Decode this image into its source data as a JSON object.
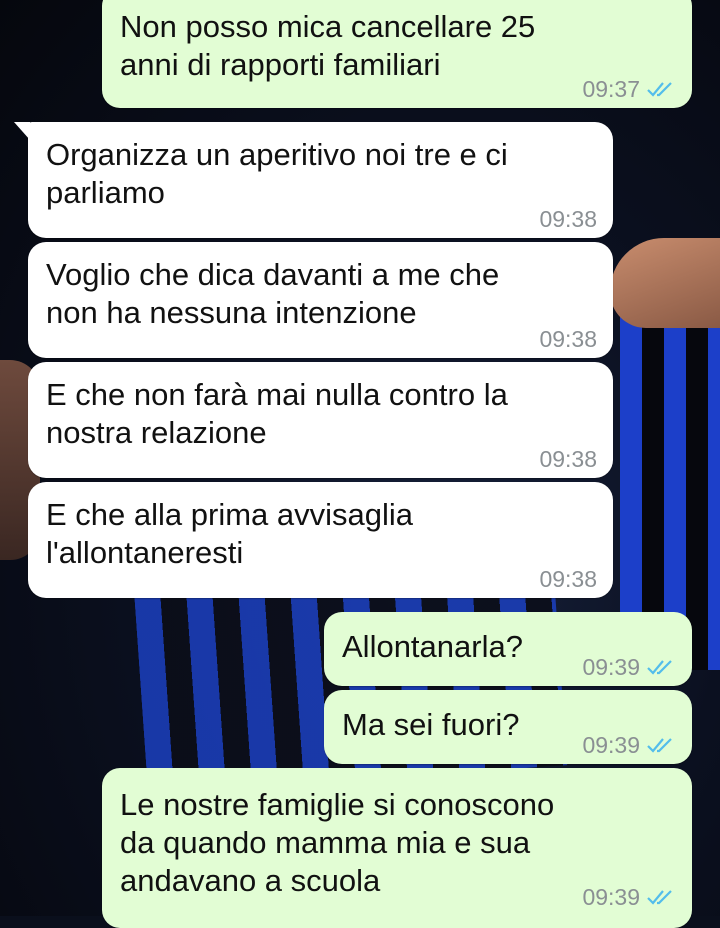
{
  "theme": {
    "outgoing_bg": "#e2fdd4",
    "incoming_bg": "#ffffff",
    "read_check_color": "#53bdeb"
  },
  "messages": [
    {
      "dir": "out",
      "text": "Non posso mica cancellare 25\nanni di rapporti familiari",
      "time": "09:37",
      "status": "read"
    },
    {
      "dir": "in",
      "text": "Organizza un aperitivo noi tre e ci\nparliamo",
      "time": "09:38"
    },
    {
      "dir": "in",
      "text": "Voglio che dica davanti a me che\nnon ha nessuna intenzione",
      "time": "09:38"
    },
    {
      "dir": "in",
      "text": "E che non farà mai nulla contro la\nnostra relazione",
      "time": "09:38"
    },
    {
      "dir": "in",
      "text": "E che alla prima avvisaglia\nl'allontaneresti",
      "time": "09:38"
    },
    {
      "dir": "out",
      "text": "Allontanarla?",
      "time": "09:39",
      "status": "read"
    },
    {
      "dir": "out",
      "text": "Ma sei fuori?",
      "time": "09:39",
      "status": "read"
    },
    {
      "dir": "out",
      "text": "Le nostre famiglie si conoscono\nda quando mamma mia e sua\nandavano a scuola",
      "time": "09:39",
      "status": "read"
    }
  ]
}
